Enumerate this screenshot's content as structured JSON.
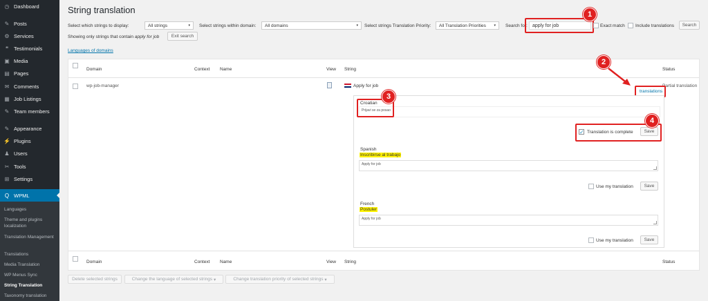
{
  "sidebar": {
    "items": [
      {
        "label": "Dashboard",
        "icon": "dashboard-icon",
        "glyph": "◷"
      },
      {
        "label": "Posts",
        "icon": "pin-icon",
        "glyph": "✎"
      },
      {
        "label": "Services",
        "icon": "services-icon",
        "glyph": "⚙"
      },
      {
        "label": "Testimonials",
        "icon": "testimonials-icon",
        "glyph": "❝"
      },
      {
        "label": "Media",
        "icon": "media-icon",
        "glyph": "▣"
      },
      {
        "label": "Pages",
        "icon": "pages-icon",
        "glyph": "▤"
      },
      {
        "label": "Comments",
        "icon": "comments-icon",
        "glyph": "✉"
      },
      {
        "label": "Job Listings",
        "icon": "job-listings-icon",
        "glyph": "▦"
      },
      {
        "label": "Team members",
        "icon": "team-icon",
        "glyph": "✎"
      },
      {
        "label": "Appearance",
        "icon": "appearance-icon",
        "glyph": "✎"
      },
      {
        "label": "Plugins",
        "icon": "plugins-icon",
        "glyph": "⚡"
      },
      {
        "label": "Users",
        "icon": "users-icon",
        "glyph": "♟"
      },
      {
        "label": "Tools",
        "icon": "tools-icon",
        "glyph": "✂"
      },
      {
        "label": "Settings",
        "icon": "settings-icon",
        "glyph": "⊞"
      }
    ],
    "wpml_label": "WPML",
    "wpml_glyph": "Q",
    "submenu": [
      "Languages",
      "Theme and plugins localization",
      "Translation Management",
      "Translations",
      "Media Translation",
      "WP Menus Sync",
      "String Translation",
      "Taxonomy translation"
    ]
  },
  "page_title": "String translation",
  "filters": {
    "display_label": "Select which strings to display:",
    "display_value": "All strings",
    "domain_label": "Select strings within domain:",
    "domain_value": "All domains",
    "priority_label": "Select strings Translation Priority:",
    "priority_value": "All Translation Priorities",
    "search_label": "Search for:",
    "search_value": "apply for job",
    "exact_match_label": "Exact match",
    "include_translations_label": "Include translations",
    "search_button": "Search",
    "caret": "▾"
  },
  "showing_only": {
    "prefix": "Showing only strings that contain",
    "term": "apply for job",
    "exit_button": "Exit search"
  },
  "languages_of_domains_link": "Languages of domains",
  "table": {
    "headers": {
      "domain": "Domain",
      "context": "Context",
      "name": "Name",
      "view": "View",
      "string": "String",
      "status": "Status"
    },
    "row": {
      "domain": "wp-job-manager",
      "string": "Apply for job",
      "status": "Partial translation",
      "translations_link": "translations"
    }
  },
  "translations_panel": {
    "croatian": {
      "lang": "Croatian",
      "value": "Prijavi se za posao"
    },
    "complete_label": "Translation is complete",
    "save_label": "Save",
    "spanish": {
      "lang": "Spanish",
      "highlight": "Inscribirse al trabajo",
      "placeholder": "Apply for job"
    },
    "french": {
      "lang": "French",
      "highlight": "Postuler",
      "placeholder": "Apply for job"
    },
    "use_my_translation": "Use my translation",
    "check_mark": "✓"
  },
  "bulk_actions": {
    "delete": "Delete selected strings",
    "change_language": "Change the language of selected strings",
    "change_priority": "Change translation priority of selected strings"
  },
  "annotations": [
    "1",
    "2",
    "3",
    "4"
  ],
  "colors": {
    "accent": "#0073aa",
    "annotation": "#e02020",
    "highlight": "#fff200"
  }
}
